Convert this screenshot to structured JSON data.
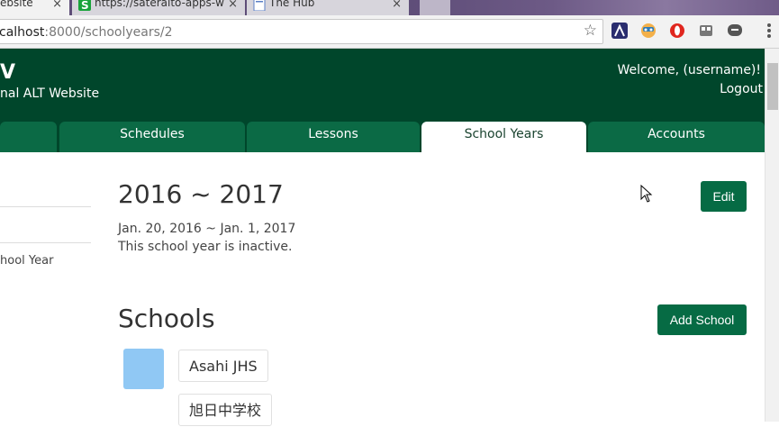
{
  "browser": {
    "tabs": [
      {
        "title": "ebsite",
        "active": true
      },
      {
        "title": "https://sateraito-apps-w",
        "active": false
      },
      {
        "title": "The Hub",
        "active": false
      }
    ],
    "url_host": "calhost",
    "url_path": ":8000/schoolyears/2"
  },
  "header": {
    "brand": "V",
    "subtitle": "nal ALT Website",
    "welcome": "Welcome, (username)!",
    "logout": "Logout",
    "bg_color": "#00462b"
  },
  "nav": {
    "tabs": [
      {
        "label": "",
        "active": false
      },
      {
        "label": "Schedules",
        "active": false
      },
      {
        "label": "Lessons",
        "active": false
      },
      {
        "label": "School Years",
        "active": true
      },
      {
        "label": "Accounts",
        "active": false
      }
    ]
  },
  "sidebar": {
    "link": "hool Year"
  },
  "school_year": {
    "title": "2016 ~ 2017",
    "dates": "Jan. 20, 2016 ~ Jan. 1, 2017",
    "status": "This school year is inactive.",
    "edit_label": "Edit"
  },
  "schools": {
    "title": "Schools",
    "add_label": "Add School",
    "items": [
      {
        "name_en": "Asahi JHS",
        "name_ja": "旭日中学校",
        "color": "#90c8f4"
      }
    ]
  },
  "colors": {
    "accent": "#066b44",
    "tab": "#0b6a45"
  }
}
